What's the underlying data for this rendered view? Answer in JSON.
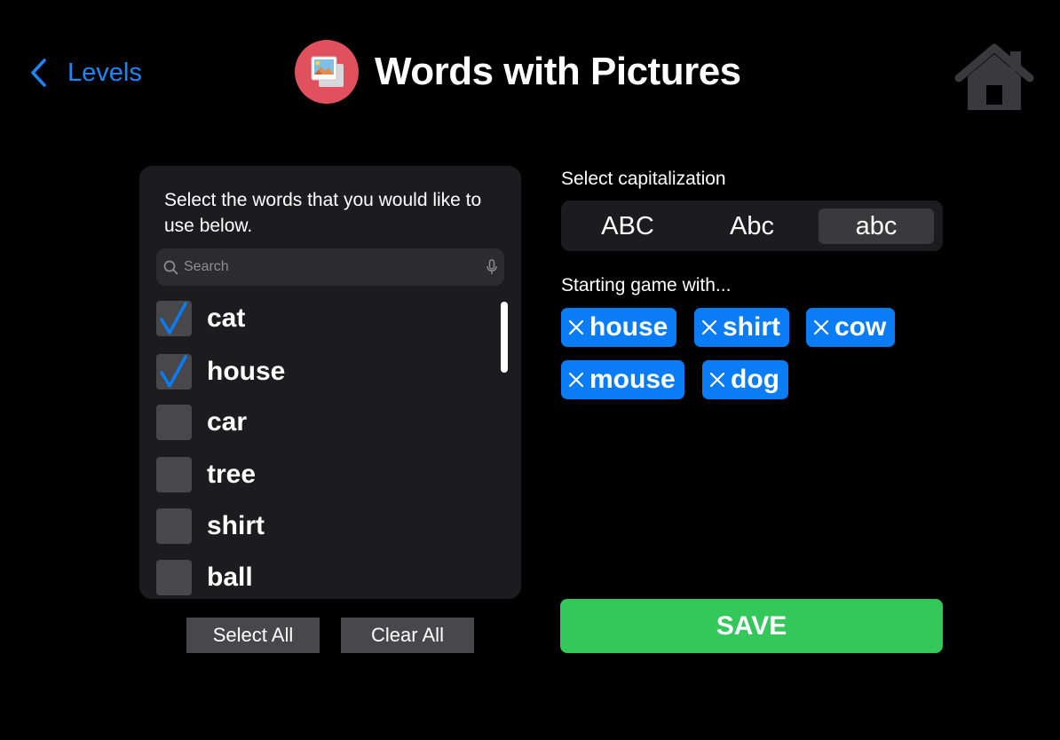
{
  "header": {
    "back_label": "Levels",
    "title": "Words with Pictures",
    "icons": {
      "back": "chevron-left-icon",
      "app": "photos-icon",
      "home": "home-icon"
    }
  },
  "word_panel": {
    "instructions": "Select the words that you would like to use below.",
    "search_placeholder": "Search",
    "words": [
      {
        "label": "cat",
        "checked": true
      },
      {
        "label": "house",
        "checked": true
      },
      {
        "label": "car",
        "checked": false
      },
      {
        "label": "tree",
        "checked": false
      },
      {
        "label": "shirt",
        "checked": false
      },
      {
        "label": "ball",
        "checked": false
      }
    ],
    "select_all_label": "Select All",
    "clear_all_label": "Clear All"
  },
  "capitalization": {
    "label": "Select capitalization",
    "options": [
      "ABC",
      "Abc",
      "abc"
    ],
    "selected": "abc"
  },
  "starting": {
    "label": "Starting game with...",
    "chips": [
      "house",
      "shirt",
      "cow",
      "mouse",
      "dog"
    ]
  },
  "save_label": "SAVE",
  "colors": {
    "accent_blue": "#0a7cf5",
    "link_blue": "#1e85f5",
    "save_green": "#34c759",
    "app_icon_red": "#e0505d"
  }
}
